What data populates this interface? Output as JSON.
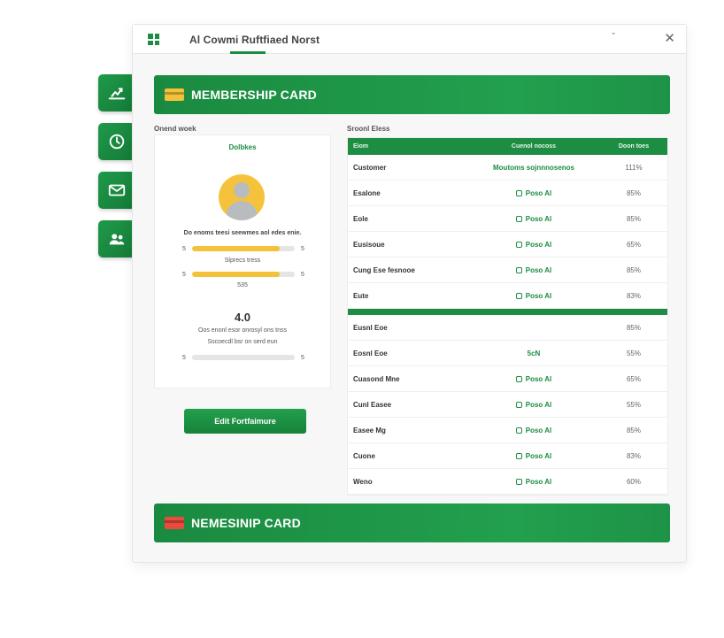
{
  "dock": {
    "items": [
      {
        "name": "dock-analytics-button",
        "icon": "chart-icon"
      },
      {
        "name": "dock-history-button",
        "icon": "clock-icon"
      },
      {
        "name": "dock-mail-button",
        "icon": "mail-icon"
      },
      {
        "name": "dock-people-button",
        "icon": "users-icon"
      }
    ]
  },
  "window": {
    "title": "Al  Cowmi Ruftfiaed Norst",
    "chevron": "ˇ",
    "close": "✕"
  },
  "banner_top": {
    "label": "MEMBERSHIP CARD"
  },
  "banner_bottom": {
    "label": "NEMESINIP CARD"
  },
  "profile": {
    "section_label": "Onend woek",
    "heading": "Dolbkes",
    "description": "Do enoms teesi seewmes aol edes enie.",
    "bar1": {
      "left": "5",
      "right": "5",
      "value": 0.85
    },
    "caption1": "Slprecs tress",
    "bar2": {
      "left": "5",
      "right": "5",
      "value": 0.85
    },
    "caption2": "535",
    "big_number": "4.0",
    "line1": "Oos enonl esor onrosyl ons tnss",
    "line2": "Sscoecdl bsr on serd eun",
    "bar3": {
      "left": "5",
      "right": "5",
      "value": 0.0
    }
  },
  "action_button": {
    "label": "Edit Fortfaimure"
  },
  "table": {
    "section_label": "Sroonl Eless",
    "headers": [
      "Eiom",
      "Cuenol nocoss",
      "Doon toes"
    ],
    "rows_a": [
      {
        "name": "Customer",
        "status": "Moutoms sojnnnosenos",
        "pct": "111%",
        "badge": false
      },
      {
        "name": "Esalone",
        "status": "Poso Al",
        "pct": "85%",
        "badge": true
      },
      {
        "name": "Eole",
        "status": "Poso Al",
        "pct": "85%",
        "badge": true
      },
      {
        "name": "Eusisoue",
        "status": "Poso Al",
        "pct": "65%",
        "badge": true
      },
      {
        "name": "Cung Ese fesnooe",
        "status": "Poso Al",
        "pct": "85%",
        "badge": true
      },
      {
        "name": "Eute",
        "status": "Poso Al",
        "pct": "83%",
        "badge": true
      }
    ],
    "rows_b": [
      {
        "name": "Eusnl Eoe",
        "status": "",
        "pct": "85%",
        "badge": false
      },
      {
        "name": "Eosnl Eoe",
        "status": "5cN",
        "pct": "55%",
        "badge": false
      },
      {
        "name": "Cuasond Mne",
        "status": "Poso Al",
        "pct": "65%",
        "badge": true
      },
      {
        "name": "Cunl Easee",
        "status": "Poso Al",
        "pct": "55%",
        "badge": true
      },
      {
        "name": "Easee Mg",
        "status": "Poso Al",
        "pct": "85%",
        "badge": true
      },
      {
        "name": "Cuone",
        "status": "Poso Al",
        "pct": "83%",
        "badge": true
      },
      {
        "name": "Weno",
        "status": "Poso Al",
        "pct": "60%",
        "badge": true
      }
    ]
  },
  "colors": {
    "accent": "#1c8d42",
    "highlight": "#f3c23a",
    "alert": "#e94b3c"
  }
}
